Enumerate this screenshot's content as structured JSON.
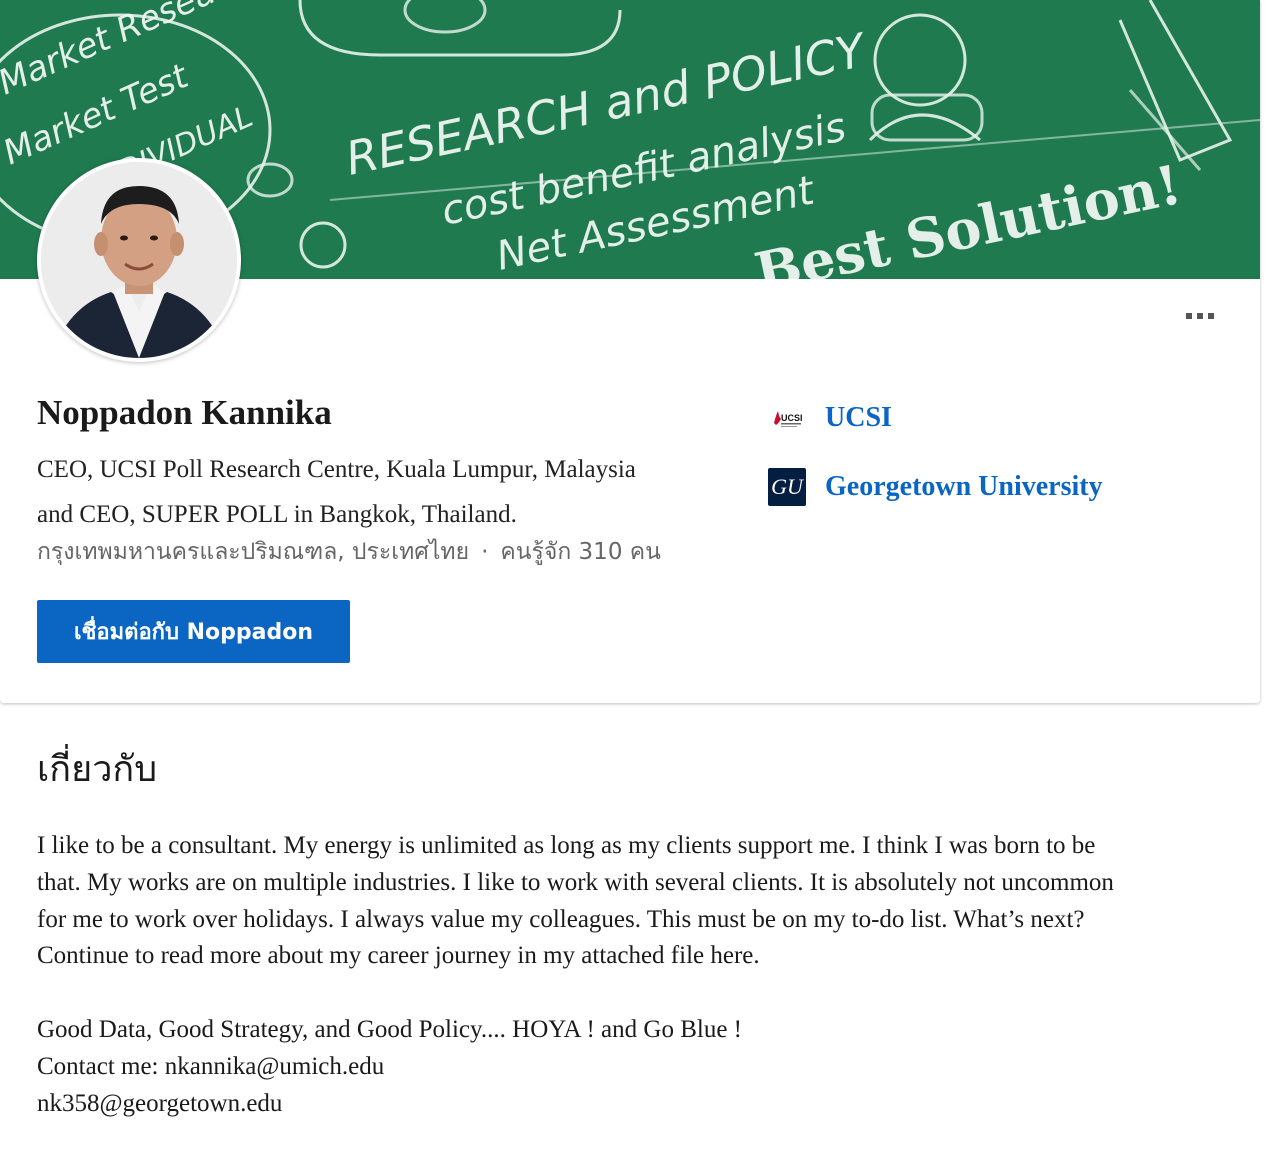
{
  "profile": {
    "name": "Noppadon Kannika",
    "headline_line1": "CEO, UCSI Poll Research Centre, Kuala Lumpur, Malaysia",
    "headline_line2": "and CEO, SUPER POLL in Bangkok, Thailand.",
    "location": "กรุงเทพมหานครและปริมณฑล, ประเทศไทย",
    "separator": "·",
    "connections": "คนรู้จัก 310 คน",
    "connect_button": "เชื่อมต่อกับ Noppadon",
    "more_icon": "more-horizontal-icon"
  },
  "banner": {
    "bg_color": "#1f7a4f",
    "chalk_texts": [
      "Market Research",
      "Market Test",
      "INDIVIDUAL",
      "RESEARCH and POLICY",
      "cost benefit analysis",
      "Net Assessment",
      "Best Solution!"
    ]
  },
  "orgs": [
    {
      "name": "UCSI",
      "logo_text": "UCSI"
    },
    {
      "name": "Georgetown University",
      "logo_text": "GU"
    }
  ],
  "about": {
    "title": "เกี่ยวกับ",
    "paragraph1": [
      "I like to be a consultant. My energy is unlimited as long as my clients support me. I think I was born to be",
      "that. My works are on multiple industries. I like to work with several clients. It is absolutely not uncommon",
      "for me to work over holidays. I always value my colleagues. This must be on my to-do list. What’s next?",
      "Continue to read more about my career journey in my attached file here."
    ],
    "paragraph2": [
      "Good Data, Good Strategy, and Good Policy.... HOYA ! and Go Blue !",
      "Contact me: nkannika@umich.edu",
      "nk358@georgetown.edu"
    ]
  },
  "colors": {
    "accent": "#0a66c2",
    "banner_green": "#1f7a4f"
  }
}
